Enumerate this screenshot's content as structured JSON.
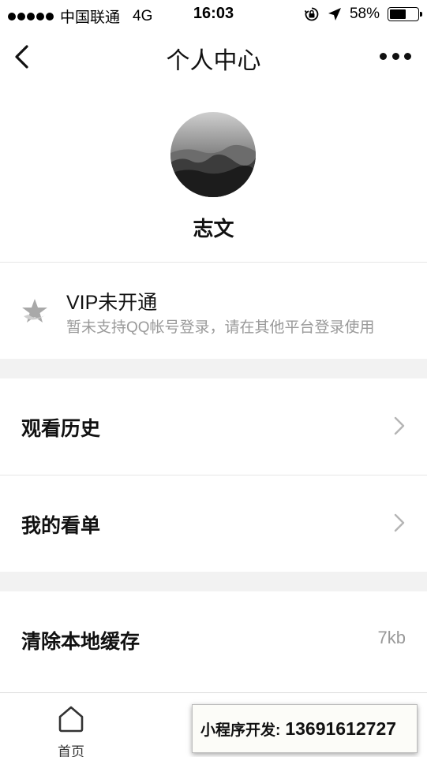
{
  "status_bar": {
    "carrier": "中国联通",
    "network": "4G",
    "time": "16:03",
    "battery": "58%",
    "battery_level": 0.58
  },
  "nav": {
    "title": "个人中心"
  },
  "profile": {
    "username": "志文"
  },
  "vip": {
    "title": "VIP未开通",
    "subtitle": "暂未支持QQ帐号登录，请在其他平台登录使用"
  },
  "menu": {
    "history": "观看历史",
    "watchlist": "我的看单",
    "clear_cache": "清除本地缓存",
    "cache_size": "7kb"
  },
  "tab_bar": {
    "home": "首页"
  },
  "promo": {
    "label": "小程序开发:",
    "phone": "13691612727"
  }
}
